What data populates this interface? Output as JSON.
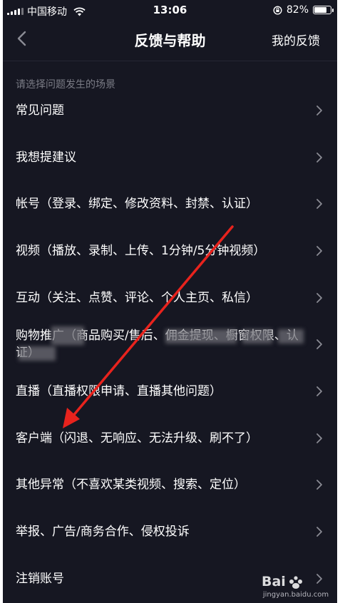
{
  "status_bar": {
    "carrier": "中国移动",
    "time": "13:06",
    "battery_percent": "82%",
    "battery_level": 0.82
  },
  "nav": {
    "title": "反馈与帮助",
    "action": "我的反馈"
  },
  "section_header": "请选择问题发生的场景",
  "items": [
    {
      "label": "常见问题"
    },
    {
      "label": "我想提建议"
    },
    {
      "label": "帐号（登录、绑定、修改资料、封禁、认证）"
    },
    {
      "label": "视频（播放、录制、上传、1分钟/5分钟视频）"
    },
    {
      "label": "互动（关注、点赞、评论、个人主页、私信）"
    },
    {
      "label": "购物推广（商品购买/售后、佣金提现、橱窗权限、认证）"
    },
    {
      "label": "直播（直播权限申请、直播其他问题）"
    },
    {
      "label": "客户端（闪退、无响应、无法升级、刷不了）"
    },
    {
      "label": "其他异常（不喜欢某类视频、搜索、定位）"
    },
    {
      "label": "举报、广告/商务合作、侵权投诉"
    },
    {
      "label": "注销账号"
    }
  ],
  "annotation": {
    "color": "#e8231d"
  },
  "watermark": {
    "text": "Bai经验",
    "url": "jingyan.baidu.com"
  }
}
